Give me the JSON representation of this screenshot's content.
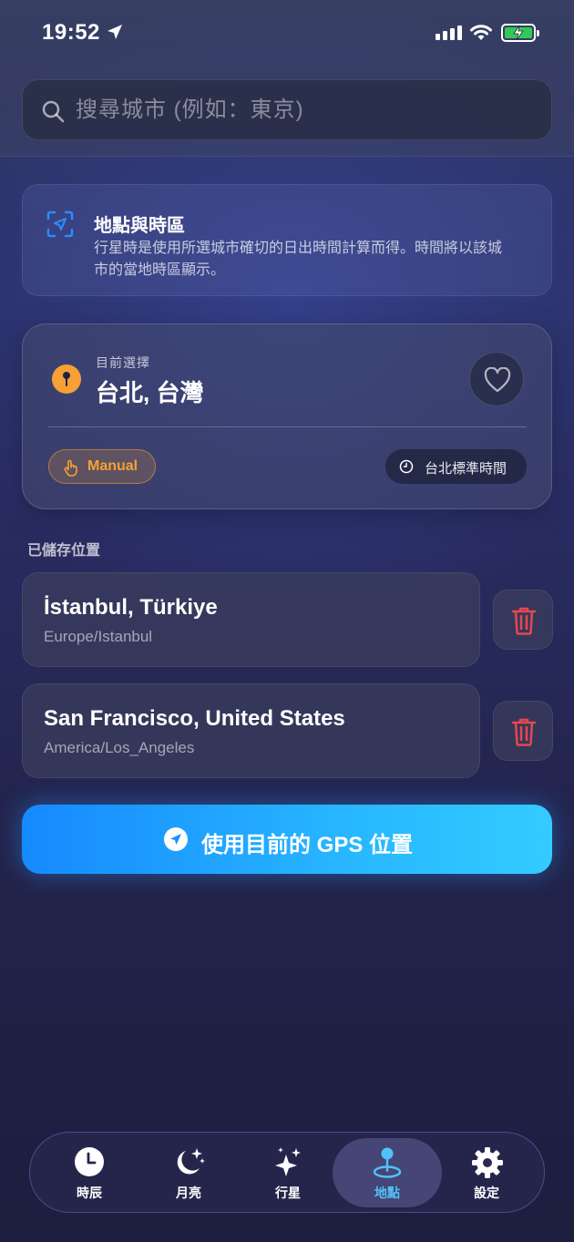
{
  "status_bar": {
    "time": "19:52",
    "icons": [
      "location-arrow-icon",
      "signal-icon",
      "wifi-icon",
      "battery-charging-icon"
    ]
  },
  "search": {
    "placeholder": "搜尋城市 (例如：東京)",
    "value": ""
  },
  "info_card": {
    "icon": "location-scan-icon",
    "title": "地點與時區",
    "text": "行星時是使用所選城市確切的日出時間計算而得。時間將以該城市的當地時區顯示。"
  },
  "current": {
    "label": "目前選擇",
    "city": "台北, 台灣",
    "pin_icon": "map-pin-icon",
    "favorite_icon": "heart-icon",
    "badge_manual": "Manual",
    "badge_timezone": "台北標準時間"
  },
  "saved": {
    "title": "已儲存位置",
    "items": [
      {
        "city": "İstanbul, Türkiye",
        "tz": "Europe/Istanbul"
      },
      {
        "city": "San Francisco, United States",
        "tz": "America/Los_Angeles"
      }
    ]
  },
  "gps_button": {
    "label": "使用目前的 GPS 位置"
  },
  "tabs": [
    {
      "label": "時辰",
      "icon": "clock-icon",
      "active": false
    },
    {
      "label": "月亮",
      "icon": "moon-stars-icon",
      "active": false
    },
    {
      "label": "行星",
      "icon": "sparkles-icon",
      "active": false
    },
    {
      "label": "地點",
      "icon": "location-pin-icon",
      "active": true
    },
    {
      "label": "設定",
      "icon": "gear-icon",
      "active": false
    }
  ],
  "colors": {
    "accent_blue": "#27b6ff",
    "accent_orange": "#f7a035",
    "delete_red": "#e5484d",
    "active_tab": "#4fc3f7",
    "battery_green": "#34c759"
  }
}
